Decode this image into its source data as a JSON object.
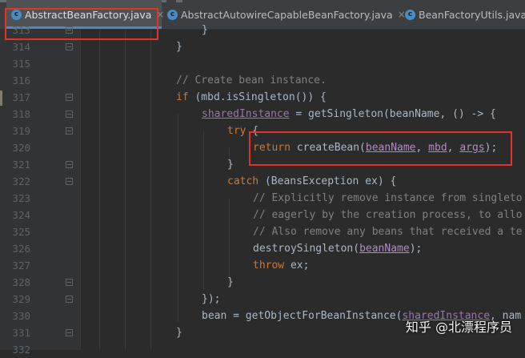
{
  "tabs": [
    {
      "label": "AbstractBeanFactory.java",
      "active": true,
      "close": "×"
    },
    {
      "label": "AbstractAutowireCapableBeanFactory.java",
      "active": false,
      "close": "×"
    },
    {
      "label": "BeanFactoryUtils.java",
      "active": false,
      "close": "×"
    }
  ],
  "tab_icon_letter": "c",
  "line_numbers": [
    "313",
    "314",
    "315",
    "316",
    "317",
    "318",
    "319",
    "320",
    "321",
    "322",
    "323",
    "324",
    "325",
    "326",
    "327",
    "328",
    "329",
    "330",
    "331",
    "332"
  ],
  "code": {
    "l313": "}",
    "l314": "}",
    "l316": "// Create bean instance.",
    "l317_kw": "if",
    "l317_rest": " (mbd.isSingleton()) {",
    "l318_var": "sharedInstance",
    "l318_rest": " = getSingleton(beanName, () -> {",
    "l319_kw": "try",
    "l319_rest": " {",
    "l320_kw": "return",
    "l320_call": " createBean(",
    "l320_p1": "beanName",
    "l320_sep1": ", ",
    "l320_p2": "mbd",
    "l320_sep2": ", ",
    "l320_p3": "args",
    "l320_end": ");",
    "l321": "}",
    "l322_kw": "catch",
    "l322_rest": " (BeansException ex) {",
    "l323": "// Explicitly remove instance from singleto",
    "l324": "// eagerly by the creation process, to allo",
    "l325": "// Also remove any beans that received a te",
    "l326_call": "destroySingleton(",
    "l326_p": "beanName",
    "l326_end": ");",
    "l327_kw": "throw",
    "l327_rest": " ex;",
    "l328": "}",
    "l329": "});",
    "l330_pre": "bean = getObjectForBeanInstance(",
    "l330_var": "sharedInstance",
    "l330_rest": ", nam",
    "l331": "}"
  },
  "watermark": "知乎 @北漂程序员",
  "colors": {
    "keyword": "#cc7832",
    "comment": "#808080",
    "text": "#a9b7c6",
    "field": "#9876aa",
    "highlight": "#e0332a"
  }
}
